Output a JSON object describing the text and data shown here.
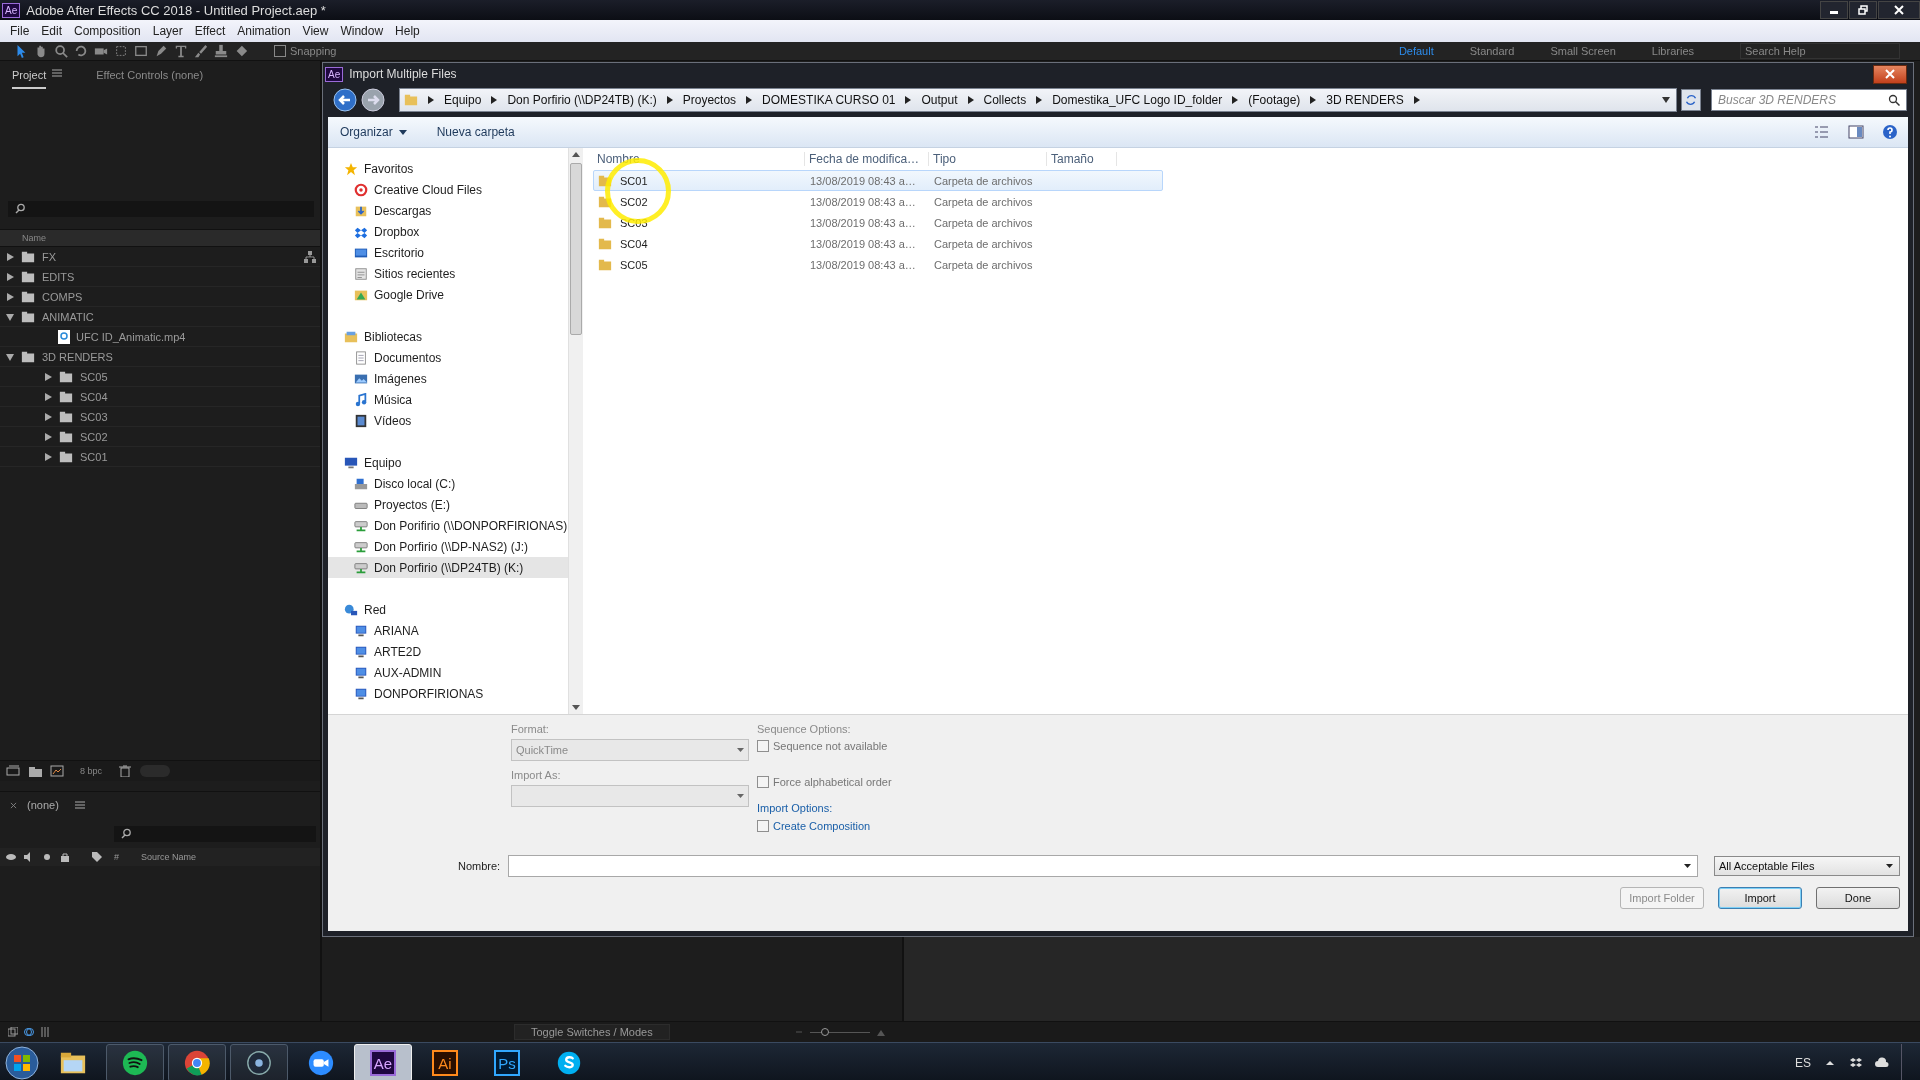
{
  "app_window": {
    "badge": "Ae",
    "title": "Adobe After Effects CC 2018 - Untitled Project.aep *"
  },
  "menu": [
    "File",
    "Edit",
    "Composition",
    "Layer",
    "Effect",
    "Animation",
    "View",
    "Window",
    "Help"
  ],
  "toolbar": {
    "tools": [
      {
        "kind": "selection",
        "selected": true
      },
      {
        "kind": "hand",
        "selected": false
      },
      {
        "kind": "zoom",
        "selected": false
      },
      {
        "kind": "rotate",
        "selected": false
      },
      {
        "kind": "camera",
        "selected": false
      },
      {
        "kind": "pan",
        "selected": false
      },
      {
        "kind": "rectangle",
        "selected": false
      },
      {
        "kind": "pen",
        "selected": false
      },
      {
        "kind": "type",
        "selected": false
      },
      {
        "kind": "brush",
        "selected": false
      },
      {
        "kind": "stamp",
        "selected": false
      },
      {
        "kind": "eraser",
        "selected": false
      }
    ],
    "snapping": {
      "label": "Snapping",
      "checked": false
    },
    "workspaces": [
      {
        "label": "Default",
        "selected": true
      },
      {
        "label": "Standard",
        "selected": false
      },
      {
        "label": "Small Screen",
        "selected": false
      },
      {
        "label": "Libraries",
        "selected": false
      }
    ],
    "search_placeholder": "Search Help"
  },
  "project_panel": {
    "tabs": [
      {
        "label": "Project",
        "selected": true
      },
      {
        "label": "Effect Controls (none)",
        "selected": false
      }
    ],
    "column": "Name",
    "items": [
      {
        "name": "FX",
        "kind": "folder",
        "expanded": false
      },
      {
        "name": "EDITS",
        "kind": "folder",
        "expanded": false
      },
      {
        "name": "COMPS",
        "kind": "folder",
        "expanded": false
      },
      {
        "name": "ANIMATIC",
        "kind": "folder",
        "expanded": true,
        "children": [
          {
            "name": "UFC ID_Animatic.mp4",
            "kind": "file"
          }
        ]
      },
      {
        "name": "3D RENDERS",
        "kind": "folder",
        "expanded": true,
        "children": [
          {
            "name": "SC05",
            "kind": "folder",
            "expanded": false
          },
          {
            "name": "SC04",
            "kind": "folder",
            "expanded": false
          },
          {
            "name": "SC03",
            "kind": "folder",
            "expanded": false
          },
          {
            "name": "SC02",
            "kind": "folder",
            "expanded": false
          },
          {
            "name": "SC01",
            "kind": "folder",
            "expanded": false
          }
        ]
      }
    ],
    "bpc": "8 bpc",
    "toggle": {
      "on": false
    }
  },
  "timeline_panel": {
    "tab": "(none)",
    "columns": [
      "#",
      "Source Name"
    ],
    "footer": "Toggle Switches / Modes",
    "zoom": {
      "level": 0.25
    }
  },
  "dialog": {
    "badge": "Ae",
    "title": "Import Multiple Files",
    "breadcrumb": [
      "Equipo",
      "Don Porfirio (\\\\DP24TB) (K:)",
      "Proyectos",
      "DOMESTIKA CURSO 01",
      "Output",
      "Collects",
      "Domestika_UFC Logo ID_folder",
      "(Footage)",
      "3D RENDERS"
    ],
    "search_placeholder": "Buscar 3D RENDERS",
    "commands": [
      {
        "label": "Organizar",
        "kind": "menu"
      },
      {
        "label": "Nueva carpeta",
        "kind": "plain"
      }
    ],
    "nav": [
      {
        "label": "Favoritos",
        "kind": "star",
        "items": [
          {
            "label": "Creative Cloud Files",
            "kind": "cc",
            "selected": false
          },
          {
            "label": "Descargas",
            "kind": "download",
            "selected": false
          },
          {
            "label": "Dropbox",
            "kind": "dropbox",
            "selected": false
          },
          {
            "label": "Escritorio",
            "kind": "desktop",
            "selected": false
          },
          {
            "label": "Sitios recientes",
            "kind": "recent",
            "selected": false
          },
          {
            "label": "Google Drive",
            "kind": "folder",
            "selected": false
          }
        ]
      },
      {
        "label": "Bibliotecas",
        "kind": "library",
        "items": [
          {
            "label": "Documentos",
            "kind": "document",
            "selected": false
          },
          {
            "label": "Imágenes",
            "kind": "image",
            "selected": false
          },
          {
            "label": "Música",
            "kind": "music",
            "selected": false
          },
          {
            "label": "Vídeos",
            "kind": "video",
            "selected": false
          }
        ]
      },
      {
        "label": "Equipo",
        "kind": "computer",
        "items": [
          {
            "label": "Disco local (C:)",
            "kind": "disk",
            "selected": false
          },
          {
            "label": "Proyectos (E:)",
            "kind": "drive",
            "selected": false
          },
          {
            "label": "Don Porifirio (\\\\DONPORFIRIONAS)",
            "kind": "netdrive",
            "selected": false
          },
          {
            "label": "Don Porfirio (\\\\DP-NAS2) (J:)",
            "kind": "netdrive",
            "selected": false
          },
          {
            "label": "Don Porfirio (\\\\DP24TB) (K:)",
            "kind": "netdrive",
            "selected": true
          }
        ]
      },
      {
        "label": "Red",
        "kind": "network",
        "items": [
          {
            "label": "ARIANA",
            "kind": "host",
            "selected": false
          },
          {
            "label": "ARTE2D",
            "kind": "host",
            "selected": false
          },
          {
            "label": "AUX-ADMIN",
            "kind": "host",
            "selected": false
          },
          {
            "label": "DONPORFIRIONAS",
            "kind": "host",
            "selected": false
          }
        ]
      }
    ],
    "columns": [
      "Nombre",
      "Fecha de modifica…",
      "Tipo",
      "Tamaño"
    ],
    "files": [
      {
        "name": "SC01",
        "date": "13/08/2019 08:43 a…",
        "type": "Carpeta de archivos",
        "selected": true
      },
      {
        "name": "SC02",
        "date": "13/08/2019 08:43 a…",
        "type": "Carpeta de archivos",
        "selected": false
      },
      {
        "name": "SC03",
        "date": "13/08/2019 08:43 a…",
        "type": "Carpeta de archivos",
        "selected": false
      },
      {
        "name": "SC04",
        "date": "13/08/2019 08:43 a…",
        "type": "Carpeta de archivos",
        "selected": false
      },
      {
        "name": "SC05",
        "date": "13/08/2019 08:43 a…",
        "type": "Carpeta de archivos",
        "selected": false
      }
    ],
    "format": {
      "label": "Format:",
      "value": "QuickTime"
    },
    "import_as": {
      "label": "Import As:"
    },
    "sequence_label": "Sequence Options:",
    "sequence_checks": [
      {
        "label": "Sequence not available",
        "checked": false,
        "disabled": true
      },
      {
        "label": "Force alphabetical order",
        "checked": false,
        "disabled": true
      }
    ],
    "import_options_label": "Import Options:",
    "create_composition": {
      "label": "Create Composition",
      "checked": false
    },
    "filename_label": "Nombre:",
    "filter": "All Acceptable Files",
    "buttons": [
      {
        "label": "Import Folder",
        "disabled": true,
        "focused": false
      },
      {
        "label": "Import",
        "disabled": false,
        "focused": true
      },
      {
        "label": "Done",
        "disabled": false,
        "focused": false
      }
    ]
  },
  "taskbar": {
    "apps": [
      {
        "kind": "explorer",
        "running": false,
        "selected": false
      },
      {
        "kind": "spotify",
        "running": true,
        "selected": false
      },
      {
        "kind": "chrome",
        "running": true,
        "selected": false
      },
      {
        "kind": "recorder",
        "running": true,
        "selected": false
      },
      {
        "kind": "zoom",
        "running": false,
        "selected": false
      },
      {
        "kind": "ae",
        "label": "Ae",
        "running": true,
        "selected": true
      },
      {
        "kind": "ai",
        "label": "Ai",
        "running": false,
        "selected": false
      },
      {
        "kind": "ps",
        "label": "Ps",
        "running": false,
        "selected": false
      },
      {
        "kind": "skype",
        "running": false,
        "selected": false
      }
    ],
    "language": "ES"
  }
}
